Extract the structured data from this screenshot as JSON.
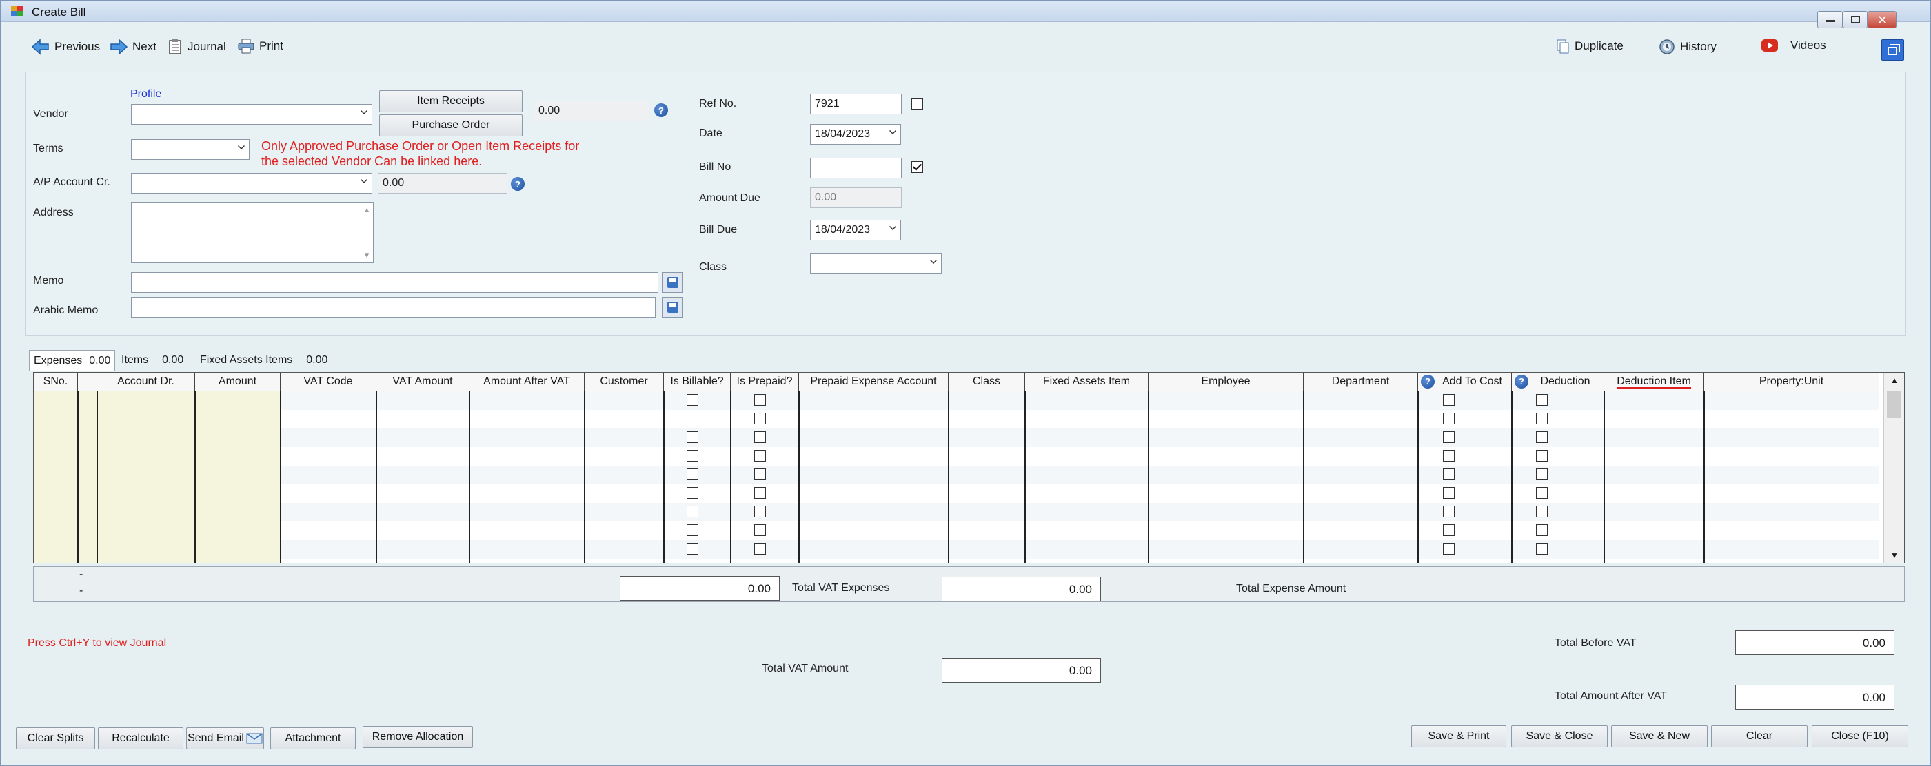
{
  "window": {
    "title": "Create Bill"
  },
  "toolbar": {
    "previous": "Previous",
    "next": "Next",
    "journal": "Journal",
    "print": "Print",
    "duplicate": "Duplicate",
    "history": "History",
    "videos": "Videos"
  },
  "form": {
    "profile_link": "Profile",
    "vendor_label": "Vendor",
    "terms_label": "Terms",
    "ap_account_label": "A/P Account Cr.",
    "address_label": "Address",
    "memo_label": "Memo",
    "arabic_memo_label": "Arabic Memo",
    "item_receipts_button": "Item Receipts",
    "purchase_order_button": "Purchase Order",
    "po_amount": "0.00",
    "ap_amount": "0.00",
    "notice": "Only Approved Purchase Order or Open Item Receipts for the selected Vendor Can be linked here.",
    "notice_line1": "Only Approved Purchase Order or Open Item Receipts for",
    "notice_line2": "the selected Vendor Can be linked here.",
    "ref_no_label": "Ref No.",
    "ref_no_value": "7921",
    "ref_no_checked": false,
    "date_label": "Date",
    "date_value": "18/04/2023",
    "bill_no_label": "Bill No",
    "bill_no_value": "",
    "bill_no_checked": true,
    "amount_due_label": "Amount Due",
    "amount_due_placeholder": "0.00",
    "bill_due_label": "Bill Due",
    "bill_due_value": "18/04/2023",
    "class_label": "Class"
  },
  "tabs": [
    {
      "label": "Expenses",
      "value": "0.00",
      "active": true
    },
    {
      "label": "Items",
      "value": "0.00",
      "active": false
    },
    {
      "label": "Fixed Assets Items",
      "value": "0.00",
      "active": false
    }
  ],
  "grid": {
    "columns": [
      "SNo.",
      "",
      "Account Dr.",
      "Amount",
      "VAT Code",
      "VAT Amount",
      "Amount After VAT",
      "Customer",
      "Is Billable?",
      "Is Prepaid?",
      "Prepaid Expense Account",
      "Class",
      "Fixed Assets Item",
      "Employee",
      "Department",
      "Add To Cost",
      "Deduction",
      "Deduction Item",
      "Property:Unit"
    ],
    "row_count": 9
  },
  "totals": {
    "footer_dash1": "-",
    "footer_dash2": "-",
    "total_vat_expenses_value": "0.00",
    "total_vat_expenses_label": "Total VAT Expenses",
    "total_expense_amount_value": "0.00",
    "total_expense_amount_label": "Total Expense Amount",
    "hint": "Press Ctrl+Y to view Journal",
    "total_vat_amount_label": "Total VAT Amount",
    "total_vat_amount_value": "0.00",
    "total_before_vat_label": "Total Before VAT",
    "total_before_vat_value": "0.00",
    "total_after_vat_label": "Total Amount After VAT",
    "total_after_vat_value": "0.00"
  },
  "actions": {
    "clear_splits": "Clear Splits",
    "recalculate": "Recalculate",
    "send_email": "Send Email",
    "attachment": "Attachment",
    "remove_allocation": "Remove Allocation",
    "save_print": "Save & Print",
    "save_close": "Save & Close",
    "save_new": "Save & New",
    "clear": "Clear",
    "close": "Close (F10)"
  },
  "colors": {
    "accent_blue": "#1d34d8",
    "warning_red": "#e02020",
    "grid_yellow": "#f5f4dc"
  }
}
